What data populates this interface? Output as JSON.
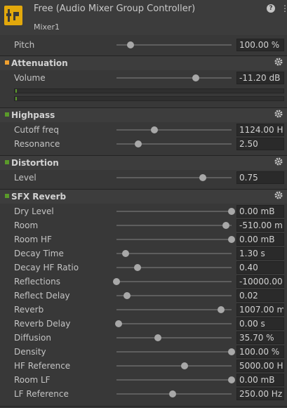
{
  "header": {
    "title": "Free (Audio Mixer Group Controller)",
    "subtitle": "Mixer1",
    "icon": "audio-mixer-icon",
    "help_icon": "?",
    "menu_icon": "⋮"
  },
  "pitch": {
    "label": "Pitch",
    "value": "100.00 %",
    "level": 0.12
  },
  "attenuation": {
    "title": "Attenuation",
    "marker_color": "#f0a030",
    "volume": {
      "label": "Volume",
      "value": "-11.20 dB",
      "level": 0.69
    }
  },
  "highpass": {
    "title": "Highpass",
    "marker_color": "#5a9a2a",
    "params": [
      {
        "label": "Cutoff freq",
        "value": "1124.00 Hz",
        "level": 0.33
      },
      {
        "label": "Resonance",
        "value": "2.50",
        "level": 0.19
      }
    ]
  },
  "distortion": {
    "title": "Distortion",
    "marker_color": "#5a9a2a",
    "params": [
      {
        "label": "Level",
        "value": "0.75",
        "level": 0.75
      }
    ]
  },
  "sfx_reverb": {
    "title": "SFX Reverb",
    "marker_color": "#5a9a2a",
    "params": [
      {
        "label": "Dry Level",
        "value": "0.00 mB",
        "level": 1.0
      },
      {
        "label": "Room",
        "value": "-510.00 mB",
        "level": 0.95
      },
      {
        "label": "Room HF",
        "value": "0.00 mB",
        "level": 1.0
      },
      {
        "label": "Decay Time",
        "value": "1.30 s",
        "level": 0.08
      },
      {
        "label": "Decay HF Ratio",
        "value": "0.40",
        "level": 0.18
      },
      {
        "label": "Reflections",
        "value": "-10000.00",
        "level": 0.0
      },
      {
        "label": "Reflect Delay",
        "value": "0.02",
        "level": 0.09
      },
      {
        "label": "Reverb",
        "value": "1007.00 mB",
        "level": 0.91
      },
      {
        "label": "Reverb Delay",
        "value": "0.00 s",
        "level": 0.02
      },
      {
        "label": "Diffusion",
        "value": "35.70 %",
        "level": 0.36
      },
      {
        "label": "Density",
        "value": "100.00 %",
        "level": 1.0
      },
      {
        "label": "HF Reference",
        "value": "5000.00 Hz",
        "level": 0.59
      },
      {
        "label": "Room LF",
        "value": "0.00 mB",
        "level": 1.0
      },
      {
        "label": "LF Reference",
        "value": "250.00 Hz",
        "level": 0.49
      }
    ]
  }
}
